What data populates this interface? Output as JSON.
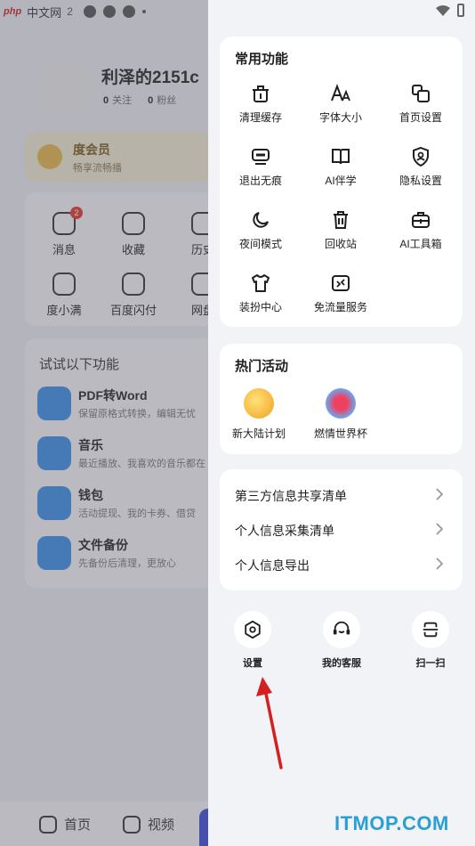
{
  "status_bar": {
    "left_badge": "php",
    "left_site": "中文网",
    "left_time": "2"
  },
  "background": {
    "user": {
      "name": "利泽的2151c",
      "following_count": "0",
      "following_label": "关注",
      "fans_count": "0",
      "fans_label": "粉丝"
    },
    "vip": {
      "title": "度会员",
      "subtitle": "畅享流畅播"
    },
    "grid": [
      {
        "label": "消息",
        "badge": "2"
      },
      {
        "label": "收藏"
      },
      {
        "label": "历史"
      },
      {
        "label": "度小满"
      },
      {
        "label": "百度闪付"
      },
      {
        "label": "网盘"
      }
    ],
    "try_section": {
      "title": "试试以下功能",
      "items": [
        {
          "name": "PDF转Word",
          "desc": "保留原格式转换，编辑无忧"
        },
        {
          "name": "音乐",
          "desc": "最近播放、我喜欢的音乐都在"
        },
        {
          "name": "钱包",
          "desc": "活动提现、我的卡券、借贷"
        },
        {
          "name": "文件备份",
          "desc": "先备份后清理，更放心"
        }
      ]
    },
    "bottom_nav": [
      {
        "label": "首页"
      },
      {
        "label": "视频"
      }
    ]
  },
  "drawer": {
    "common": {
      "title": "常用功能",
      "items": [
        {
          "label": "清理缓存",
          "icon": "broom-icon"
        },
        {
          "label": "字体大小",
          "icon": "font-size-icon"
        },
        {
          "label": "首页设置",
          "icon": "home-settings-icon"
        },
        {
          "label": "退出无痕",
          "icon": "incognito-icon"
        },
        {
          "label": "AI伴学",
          "icon": "book-icon"
        },
        {
          "label": "隐私设置",
          "icon": "privacy-shield-icon"
        },
        {
          "label": "夜间模式",
          "icon": "moon-icon"
        },
        {
          "label": "回收站",
          "icon": "trash-icon"
        },
        {
          "label": "AI工具箱",
          "icon": "toolbox-icon"
        },
        {
          "label": "装扮中心",
          "icon": "shirt-icon"
        },
        {
          "label": "免流量服务",
          "icon": "data-free-icon"
        }
      ]
    },
    "hot": {
      "title": "热门活动",
      "items": [
        {
          "label": "新大陆计划",
          "icon": "coin-icon"
        },
        {
          "label": "燃情世界杯",
          "icon": "world-cup-icon"
        }
      ]
    },
    "list": [
      {
        "label": "第三方信息共享清单"
      },
      {
        "label": "个人信息采集清单"
      },
      {
        "label": "个人信息导出"
      }
    ],
    "bottom_actions": [
      {
        "label": "设置",
        "icon": "settings-icon"
      },
      {
        "label": "我的客服",
        "icon": "headset-icon"
      },
      {
        "label": "扫一扫",
        "icon": "scan-icon"
      }
    ]
  },
  "watermark": "ITMOP.COM",
  "colors": {
    "accent_red": "#e5352b",
    "watermark_blue": "#2a9fd6",
    "nav_blue": "#3a4bd8"
  }
}
